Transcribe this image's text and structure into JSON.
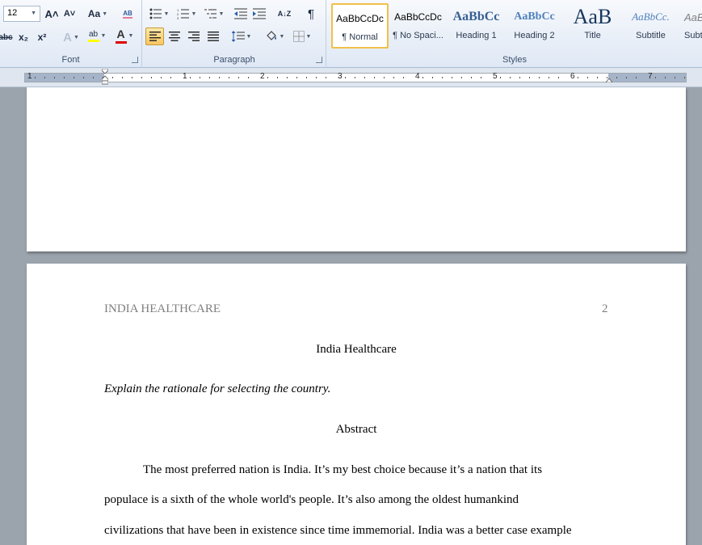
{
  "ribbon": {
    "font": {
      "label": "Font",
      "size_value": "12",
      "grow_icon": "A˄",
      "shrink_icon": "A˅",
      "case_label": "Aa",
      "clear_icon": "AB",
      "strike_label": "abc",
      "subscript_label": "x₂",
      "superscript_label": "x²",
      "effects_label": "A",
      "highlight_label": "ab",
      "color_label": "A",
      "highlight_color": "#ffff00",
      "font_color": "#e00000"
    },
    "paragraph": {
      "label": "Paragraph",
      "pilcrow": "¶",
      "sort_label": "A↓Z"
    },
    "styles": {
      "label": "Styles",
      "items": [
        {
          "preview": "AaBbCcDc",
          "name": "¶ Normal"
        },
        {
          "preview": "AaBbCcDc",
          "name": "¶ No Spaci..."
        },
        {
          "preview": "AaBbCc",
          "name": "Heading 1"
        },
        {
          "preview": "AaBbCc",
          "name": "Heading 2"
        },
        {
          "preview": "AaB",
          "name": "Title"
        },
        {
          "preview": "AaBbCc.",
          "name": "Subtitle"
        },
        {
          "preview": "AaB",
          "name": "Subt"
        }
      ]
    }
  },
  "ruler": {
    "numbers": [
      "1",
      "1",
      "2",
      "3",
      "4",
      "5",
      "6",
      "7"
    ]
  },
  "document": {
    "header_left": "INDIA HEALTHCARE",
    "page_number": "2",
    "title": "India Healthcare",
    "prompt": "Explain the rationale for selecting the country.",
    "abstract_heading": "Abstract",
    "paragraph_lines": [
      "The most preferred nation is India. It’s my best choice because it’s a nation that its",
      "populace is a sixth of the whole world's people. It’s also among the oldest humankind",
      "civilizations that have been in existence since time immemorial.  India was a better case example"
    ]
  }
}
